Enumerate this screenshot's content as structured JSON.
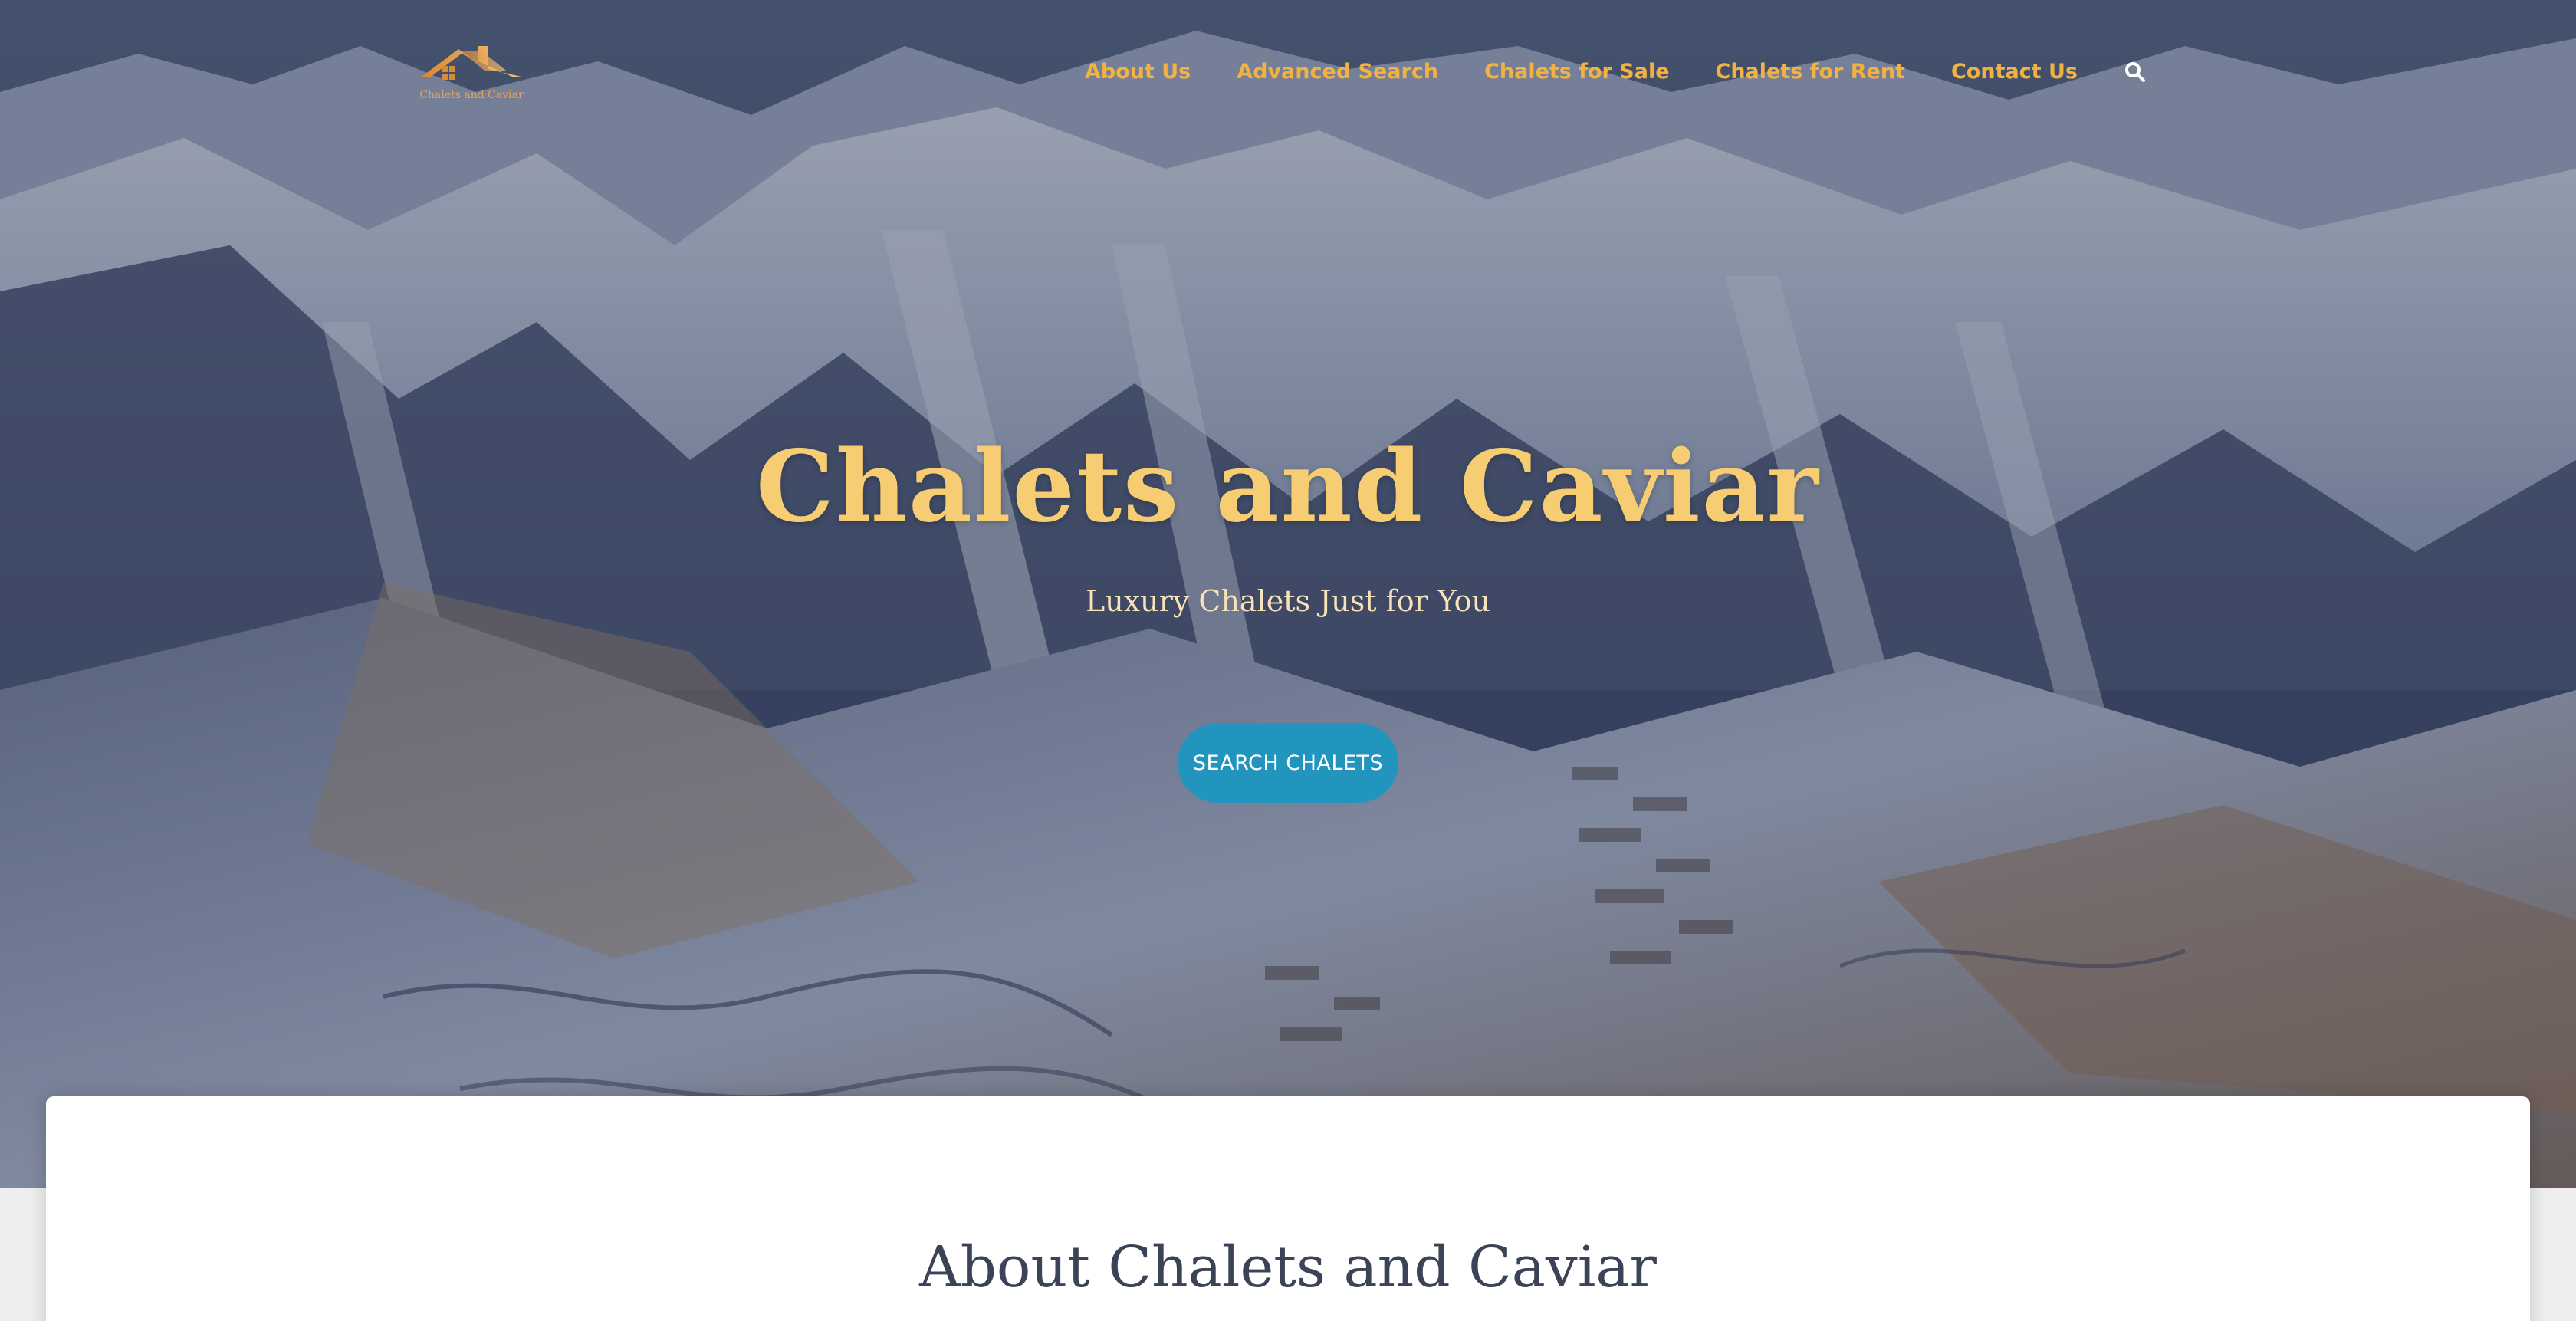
{
  "site": {
    "logo_text": "Chalets and Caviar",
    "accent_color": "#f3b141",
    "button_color": "#2295bf"
  },
  "nav": {
    "items": [
      {
        "label": "About Us"
      },
      {
        "label": "Advanced Search"
      },
      {
        "label": "Chalets for Sale"
      },
      {
        "label": "Chalets for Rent"
      },
      {
        "label": "Contact Us"
      }
    ],
    "search_icon": "search-icon"
  },
  "hero": {
    "title": "Chalets and Caviar",
    "subtitle": "Luxury Chalets Just for You",
    "button_label": "SEARCH CHALETS"
  },
  "about": {
    "title": "About Chalets and Caviar"
  }
}
